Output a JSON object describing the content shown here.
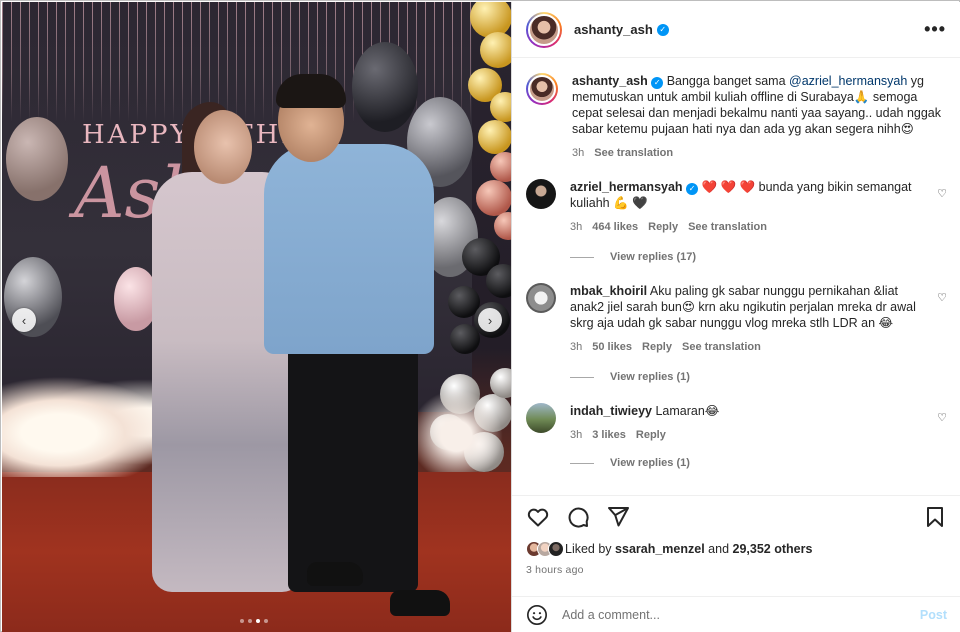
{
  "post": {
    "username": "ashanty_ash",
    "more_label": "•••",
    "carousel": {
      "prev_icon": "‹",
      "next_icon": "›",
      "dots": 4,
      "active_dot": 2
    }
  },
  "sign": {
    "line1": "HAPPY B   THD",
    "line2": "Ash"
  },
  "comments": [
    {
      "username": "ashanty_ash",
      "verified": true,
      "text_before": " Bangga banget sama ",
      "mention": "@azriel_hermansyah",
      "text_after": " yg memutuskan untuk ambil kuliah offline di Surabaya🙏 semoga cepat selesai dan menjadi bekalmu nanti yaa sayang.. udah nggak sabar ketemu pujaan hati nya dan ada yg akan segera nihh😍",
      "time": "3h",
      "see_translation": "See translation"
    },
    {
      "username": "azriel_hermansyah",
      "verified": true,
      "text": " ❤️ ❤️ ❤️  bunda yang bikin semangat kuliahh 💪 🖤",
      "time": "3h",
      "likes": "464 likes",
      "reply": "Reply",
      "see_translation": "See translation",
      "view_replies": "View replies (17)"
    },
    {
      "username": "mbak_khoiril",
      "text": " Aku paling gk sabar nunggu pernikahan &liat anak2 jiel sarah bun😍 krn aku ngikutin perjalan mreka dr awal skrg aja udah gk sabar nunggu vlog mreka stlh LDR an 😂",
      "time": "3h",
      "likes": "50 likes",
      "reply": "Reply",
      "see_translation": "See translation",
      "view_replies": "View replies (1)"
    },
    {
      "username": "indah_tiwieyy",
      "text": " Lamaran😂",
      "time": "3h",
      "likes": "3 likes",
      "reply": "Reply",
      "view_replies": "View replies (1)"
    }
  ],
  "actions": {
    "like_icon": "heart-outline",
    "comment_icon": "comment-bubble",
    "share_icon": "paper-plane",
    "save_icon": "bookmark"
  },
  "likes_line": {
    "prefix": "Liked by ",
    "user": "ssarah_menzel",
    "middle": " and ",
    "count": "29,352 others"
  },
  "posted_ago": "3 hours ago",
  "add_comment": {
    "placeholder": "Add a comment...",
    "post_label": "Post"
  },
  "colors": {
    "verified": "#0095f6",
    "mention": "#00376b",
    "muted": "#737373",
    "post_disabled": "#b2dffc"
  }
}
